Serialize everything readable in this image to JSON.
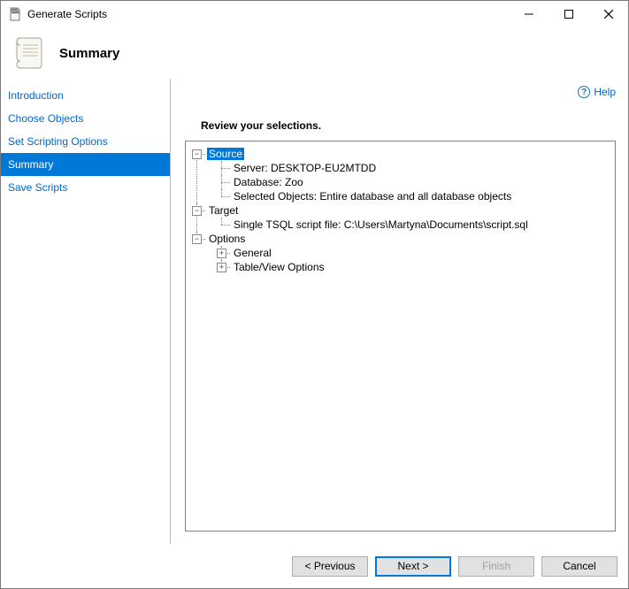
{
  "window": {
    "title": "Generate Scripts"
  },
  "header": {
    "title": "Summary"
  },
  "sidebar": {
    "items": [
      {
        "label": "Introduction",
        "active": false
      },
      {
        "label": "Choose Objects",
        "active": false
      },
      {
        "label": "Set Scripting Options",
        "active": false
      },
      {
        "label": "Summary",
        "active": true
      },
      {
        "label": "Save Scripts",
        "active": false
      }
    ]
  },
  "main": {
    "help_label": "Help",
    "review_label": "Review your selections.",
    "tree": {
      "source": {
        "label": "Source",
        "server": "Server: DESKTOP-EU2MTDD",
        "database": "Database: Zoo",
        "selected_objects": "Selected Objects: Entire database and all database objects"
      },
      "target": {
        "label": "Target",
        "file": "Single TSQL script file: C:\\Users\\Martyna\\Documents\\script.sql"
      },
      "options": {
        "label": "Options",
        "general": "General",
        "table_view": "Table/View Options"
      }
    }
  },
  "footer": {
    "previous": "< Previous",
    "next": "Next >",
    "finish": "Finish",
    "cancel": "Cancel"
  }
}
